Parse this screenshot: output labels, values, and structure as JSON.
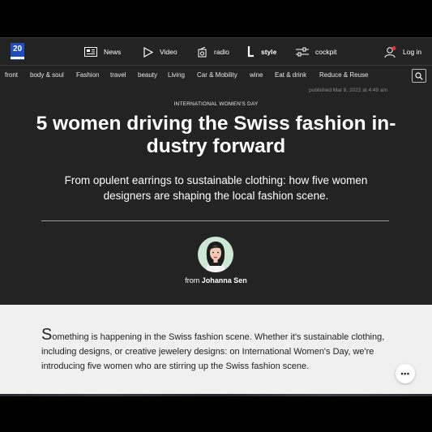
{
  "header": {
    "logo_text": "20",
    "nav": [
      {
        "label": "News",
        "icon": "newspaper-icon"
      },
      {
        "label": "Video",
        "icon": "play-icon"
      },
      {
        "label": "radio",
        "icon": "radio-icon"
      },
      {
        "label": "style",
        "icon": "style-icon",
        "active": true
      },
      {
        "label": "cockpit",
        "icon": "sliders-icon"
      }
    ],
    "login_label": "Log in",
    "notification_color": "#e03131"
  },
  "sections": [
    "front",
    "body & soul",
    "Fashion",
    "travel",
    "beauty",
    "Living",
    "Car & Mobility",
    "wine",
    "Eat & drink",
    "Reduce & Reuse"
  ],
  "article": {
    "published": "published Mar 8, 2022 at 4:49 am",
    "kicker": "INTERNATIONAL WOMEN'S DAY",
    "headline_line1": "5 women driving the Swiss fashion in-",
    "headline_line2": "dustry forward",
    "lead_line1": "From opulent earrings to sustainable clothing: how five women",
    "lead_line2": "designers are shaping the local fashion scene.",
    "byline_prefix": "from",
    "author": "Johanna Sen",
    "intro_dropcap": "S",
    "intro_rest": "omething is happening in the Swiss fashion scene. Whether it's sustainable clothing, including designs, or creative jewelery designs: on International Women's Day, we're introducing five women who are stirring up the Swiss fashion scene.",
    "more_label": "•••"
  },
  "colors": {
    "header_bg": "#232323",
    "body_bg": "#f0f0f0",
    "accent": "#1f4fbf"
  }
}
